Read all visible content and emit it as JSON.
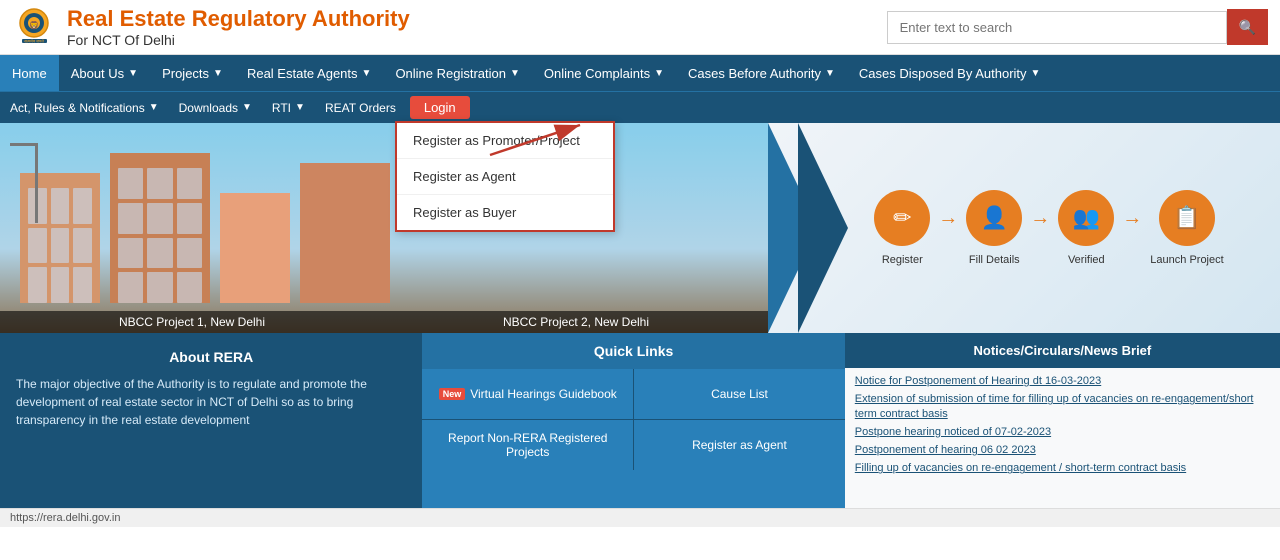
{
  "header": {
    "logo_alt": "India Emblem",
    "title_main": "Real Estate Regulatory Authority",
    "title_sub": "For NCT Of Delhi",
    "search_placeholder": "Enter text to search"
  },
  "nav_primary": {
    "items": [
      {
        "label": "Home",
        "active": true,
        "has_dropdown": false
      },
      {
        "label": "About Us",
        "active": false,
        "has_dropdown": true
      },
      {
        "label": "Projects",
        "active": false,
        "has_dropdown": true
      },
      {
        "label": "Real Estate Agents",
        "active": false,
        "has_dropdown": true
      },
      {
        "label": "Online Registration",
        "active": false,
        "has_dropdown": true
      },
      {
        "label": "Online Complaints",
        "active": false,
        "has_dropdown": true
      },
      {
        "label": "Cases Before Authority",
        "active": false,
        "has_dropdown": true
      },
      {
        "label": "Cases Disposed By Authority",
        "active": false,
        "has_dropdown": true
      }
    ]
  },
  "nav_secondary": {
    "items": [
      {
        "label": "Act, Rules & Notifications",
        "has_dropdown": true
      },
      {
        "label": "Downloads",
        "has_dropdown": true
      },
      {
        "label": "RTI",
        "has_dropdown": true
      },
      {
        "label": "REAT Orders",
        "has_dropdown": false
      }
    ],
    "login_label": "Login"
  },
  "dropdown": {
    "items": [
      {
        "label": "Register as Promoter/Project",
        "highlighted": true
      },
      {
        "label": "Register as Agent",
        "highlighted": false
      },
      {
        "label": "Register as Buyer",
        "highlighted": false
      }
    ]
  },
  "hero": {
    "caption_left": "NBCC Project 1, New Delhi",
    "caption_right": "NBCC Project 2, New Delhi",
    "steps": [
      {
        "label": "Register",
        "icon": "✏️"
      },
      {
        "label": "Fill Details",
        "icon": "👤"
      },
      {
        "label": "Verified",
        "icon": "👥"
      },
      {
        "label": "Launch Project",
        "icon": "📋"
      }
    ]
  },
  "about_rera": {
    "title": "About RERA",
    "text": "The major objective of the Authority is to regulate and promote the development of real estate sector in NCT of Delhi so as to bring transparency in the real estate development"
  },
  "quick_links": {
    "title": "Quick Links",
    "items": [
      {
        "label": "Virtual Hearings Guidebook",
        "is_new": true
      },
      {
        "label": "Cause List",
        "is_new": false
      },
      {
        "label": "Report Non-RERA Registered Projects",
        "is_new": false
      },
      {
        "label": "Register as Agent",
        "is_new": false
      }
    ]
  },
  "notices": {
    "title": "Notices/Circulars/News Brief",
    "items": [
      "Notice for Postponement of Hearing dt 16-03-2023",
      "Extension of submission of time for filling up of vacancies on re-engagement/short term contract basis",
      "Postpone hearing noticed of 07-02-2023",
      "Postponement of hearing 06 02 2023",
      "Filling up of vacancies on re-engagement / short-term contract basis"
    ]
  },
  "footer": {
    "url": "https://rera.delhi.gov.in"
  }
}
